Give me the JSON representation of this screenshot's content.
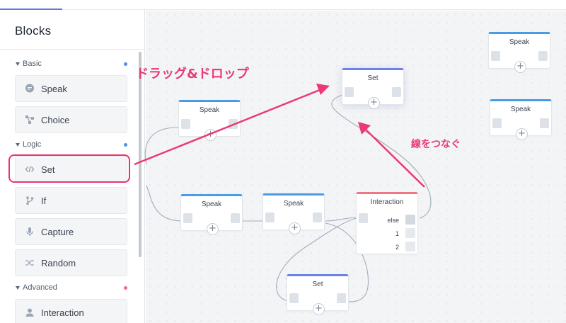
{
  "sidebar": {
    "title": "Blocks",
    "sections": [
      {
        "label": "Basic",
        "dot_color": "#4a90e2"
      },
      {
        "label": "Logic",
        "dot_color": "#4a90e2"
      },
      {
        "label": "Advanced",
        "dot_color": "#f06a86"
      }
    ],
    "items": [
      {
        "label": "Speak",
        "icon": "speech-bubble-icon"
      },
      {
        "label": "Choice",
        "icon": "branch-icon"
      },
      {
        "label": "Set",
        "icon": "code-icon"
      },
      {
        "label": "If",
        "icon": "fork-icon"
      },
      {
        "label": "Capture",
        "icon": "microphone-icon"
      },
      {
        "label": "Random",
        "icon": "shuffle-icon"
      },
      {
        "label": "Interaction",
        "icon": "user-icon"
      }
    ]
  },
  "canvas": {
    "nodes": {
      "set_top": {
        "title": "Set"
      },
      "speak_left_top": {
        "title": "Speak"
      },
      "speak_right_1": {
        "title": "Speak"
      },
      "speak_right_2": {
        "title": "Speak"
      },
      "speak_mid_1": {
        "title": "Speak"
      },
      "speak_mid_2": {
        "title": "Speak"
      },
      "set_bottom": {
        "title": "Set"
      },
      "interaction": {
        "title": "Interaction",
        "rows": [
          "else",
          "1",
          "2"
        ]
      }
    }
  },
  "annotations": {
    "drag_drop": "ドラッグ&ドロップ",
    "connect_lines": "線をつなぐ"
  },
  "colors": {
    "accent_blue": "#4a9be6",
    "set_purple": "#6c82e8",
    "interaction_red": "#ef7783",
    "annotation_pink": "#ea3a73"
  },
  "add_symbol": "+"
}
